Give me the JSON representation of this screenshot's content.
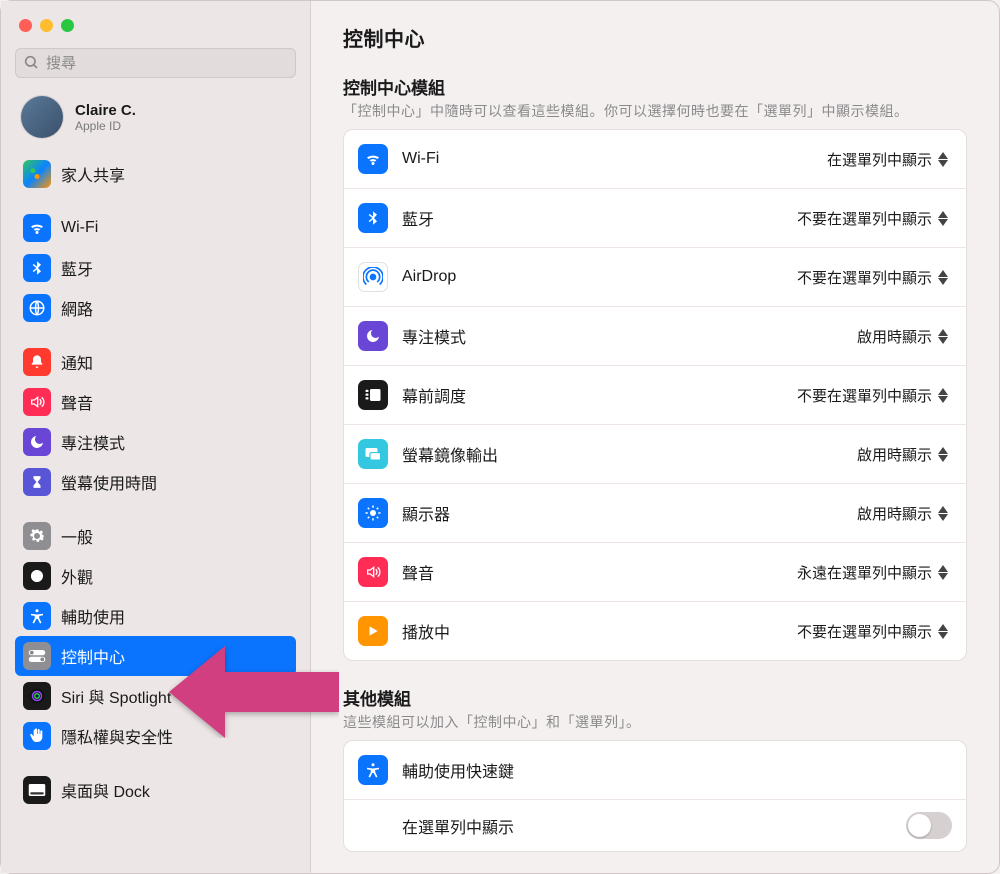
{
  "search": {
    "placeholder": "搜尋"
  },
  "account": {
    "name": "Claire C.",
    "sub": "Apple ID"
  },
  "sidebar": {
    "group0": [
      {
        "label": "家人共享",
        "icon": "family-icon",
        "bg": "bg-multi"
      }
    ],
    "group1": [
      {
        "label": "Wi-Fi",
        "icon": "wifi-icon",
        "bg": "bg-blue"
      },
      {
        "label": "藍牙",
        "icon": "bluetooth-icon",
        "bg": "bg-blue"
      },
      {
        "label": "網路",
        "icon": "globe-icon",
        "bg": "bg-blue"
      }
    ],
    "group2": [
      {
        "label": "通知",
        "icon": "bell-icon",
        "bg": "bg-red"
      },
      {
        "label": "聲音",
        "icon": "speaker-icon",
        "bg": "bg-redpink"
      },
      {
        "label": "專注模式",
        "icon": "moon-icon",
        "bg": "bg-purple"
      },
      {
        "label": "螢幕使用時間",
        "icon": "hourglass-icon",
        "bg": "bg-hourglass"
      }
    ],
    "group3": [
      {
        "label": "一般",
        "icon": "gear-icon",
        "bg": "bg-gray"
      },
      {
        "label": "外觀",
        "icon": "appearance-icon",
        "bg": "bg-black"
      },
      {
        "label": "輔助使用",
        "icon": "accessibility-icon",
        "bg": "bg-blue"
      },
      {
        "label": "控制中心",
        "icon": "control-center-icon",
        "bg": "bg-gray",
        "selected": true
      },
      {
        "label": "Siri 與 Spotlight",
        "icon": "siri-icon",
        "bg": "bg-black"
      },
      {
        "label": "隱私權與安全性",
        "icon": "hand-icon",
        "bg": "bg-blue"
      }
    ],
    "group4": [
      {
        "label": "桌面與 Dock",
        "icon": "dock-icon",
        "bg": "bg-black"
      }
    ]
  },
  "content": {
    "title": "控制中心",
    "modules": {
      "title": "控制中心模組",
      "desc": "「控制中心」中隨時可以查看這些模組。你可以選擇何時也要在「選單列」中顯示模組。",
      "rows": [
        {
          "label": "Wi-Fi",
          "value": "在選單列中顯示",
          "icon": "wifi-icon",
          "bg": "bg-blue"
        },
        {
          "label": "藍牙",
          "value": "不要在選單列中顯示",
          "icon": "bluetooth-icon",
          "bg": "bg-blue"
        },
        {
          "label": "AirDrop",
          "value": "不要在選單列中顯示",
          "icon": "airdrop-icon",
          "bg": "bg-white"
        },
        {
          "label": "專注模式",
          "value": "啟用時顯示",
          "icon": "moon-icon",
          "bg": "bg-purple"
        },
        {
          "label": "幕前調度",
          "value": "不要在選單列中顯示",
          "icon": "stage-icon",
          "bg": "bg-black"
        },
        {
          "label": "螢幕鏡像輸出",
          "value": "啟用時顯示",
          "icon": "mirror-icon",
          "bg": "bg-cyan"
        },
        {
          "label": "顯示器",
          "value": "啟用時顯示",
          "icon": "brightness-icon",
          "bg": "bg-blue"
        },
        {
          "label": "聲音",
          "value": "永遠在選單列中顯示",
          "icon": "speaker-icon",
          "bg": "bg-redpink"
        },
        {
          "label": "播放中",
          "value": "不要在選單列中顯示",
          "icon": "play-icon",
          "bg": "bg-orange"
        }
      ]
    },
    "other": {
      "title": "其他模組",
      "desc": "這些模組可以加入「控制中心」和「選單列」。",
      "rows": [
        {
          "label": "輔助使用快速鍵",
          "icon": "accessibility-icon",
          "bg": "bg-blue",
          "sublabel": "在選單列中顯示"
        }
      ]
    }
  }
}
